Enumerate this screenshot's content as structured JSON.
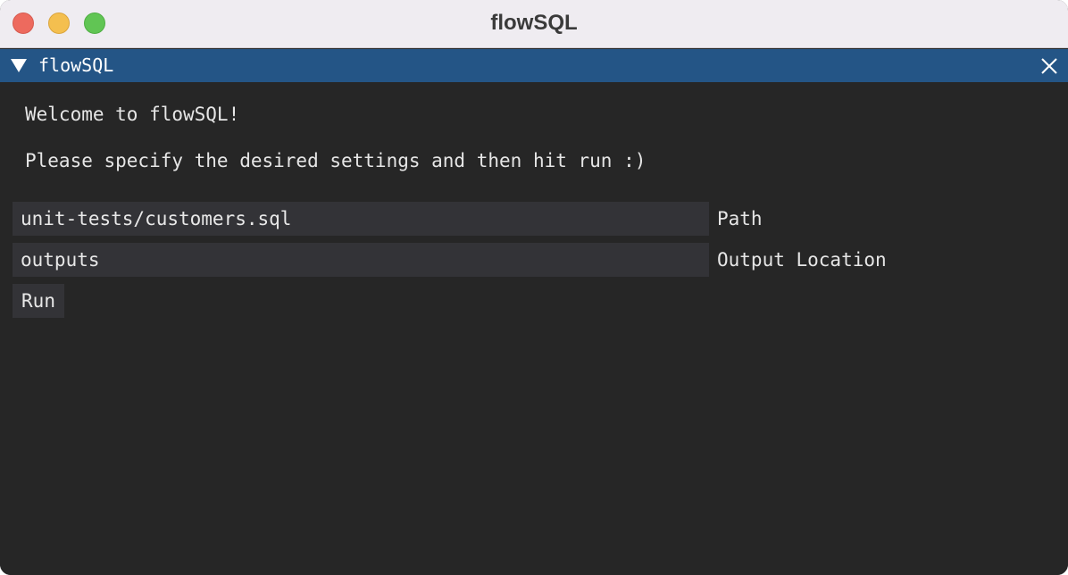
{
  "window": {
    "title": "flowSQL",
    "traffic_lights": [
      "close",
      "minimize",
      "maximize"
    ]
  },
  "panel": {
    "title": "flowSQL",
    "collapse_icon": "triangle-down-icon",
    "close_icon": "close-icon",
    "header_color": "#245586"
  },
  "content": {
    "welcome": "Welcome to flowSQL!",
    "instructions": "Please specify the desired settings and then hit run :)",
    "path": {
      "value": "unit-tests/customers.sql",
      "label": "Path"
    },
    "output": {
      "value": "outputs",
      "label": "Output Location"
    },
    "run_label": "Run"
  }
}
